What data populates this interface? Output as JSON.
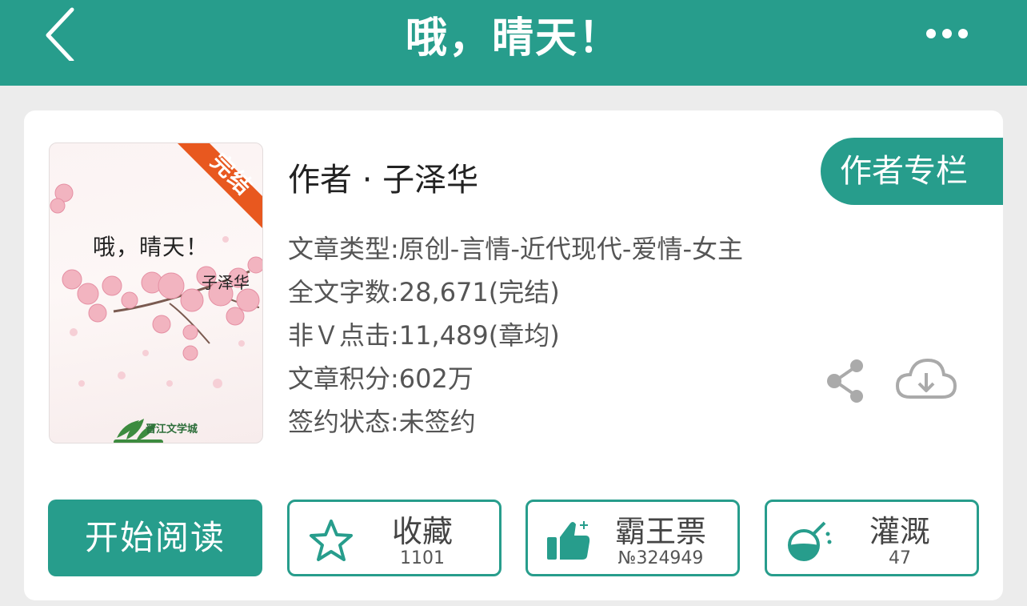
{
  "header": {
    "title": "哦，晴天！",
    "back_icon": "chevron-left-icon",
    "more_icon": "more-dots-icon"
  },
  "book": {
    "cover": {
      "title": "哦，晴天！",
      "author": "子泽华",
      "status_ribbon": "完结",
      "publisher_logo": "晋江文学城"
    },
    "author_line": "作者 · 子泽华",
    "author_column_label": "作者专栏",
    "info": [
      {
        "label": "文章类型",
        "value": "原创-言情-近代现代-爱情-女主"
      },
      {
        "label": "全文字数",
        "value": "28,671(完结)"
      },
      {
        "label": "非Ｖ点击",
        "value": "11,489(章均)"
      },
      {
        "label": "文章积分",
        "value": "602万"
      },
      {
        "label": "签约状态",
        "value": "未签约"
      }
    ],
    "share_icon": "share-icon",
    "download_icon": "cloud-download-icon"
  },
  "actions": {
    "read_label": "开始阅读",
    "favorite": {
      "label": "收藏",
      "count": "1101",
      "icon": "star-icon"
    },
    "ticket": {
      "label": "霸王票",
      "count": "№324949",
      "icon": "thumbs-up-icon"
    },
    "nutrient": {
      "label": "灌溉",
      "count": "47",
      "icon": "flask-icon"
    }
  },
  "colors": {
    "brand": "#279d8c",
    "ribbon": "#e8581f",
    "background": "#ececec"
  }
}
